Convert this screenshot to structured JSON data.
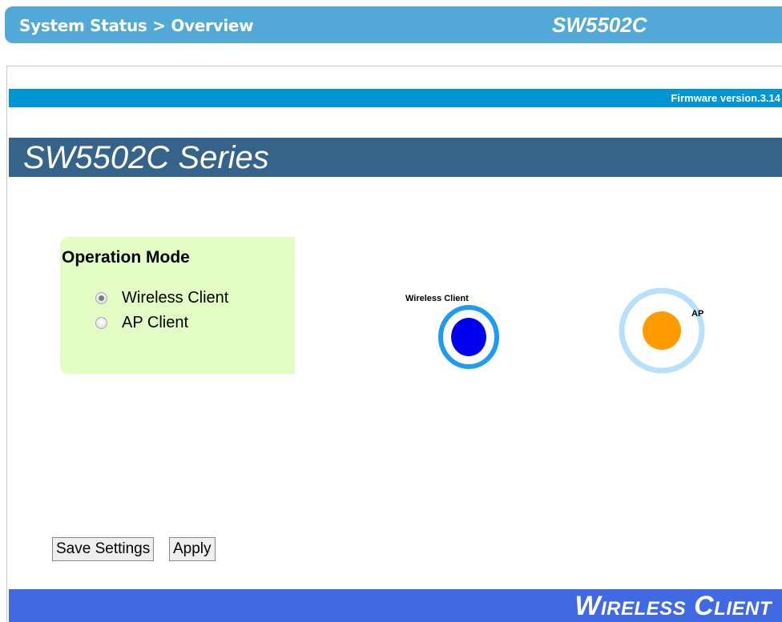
{
  "header": {
    "breadcrumb": "System Status > Overview",
    "model": "SW5502C"
  },
  "firmware": {
    "version_label": "Firmware version.3.14"
  },
  "series": {
    "title": "SW5502C Series"
  },
  "operation_mode": {
    "title": "Operation Mode",
    "options": [
      {
        "label": "Wireless Client",
        "checked": true
      },
      {
        "label": "AP Client",
        "checked": false
      }
    ]
  },
  "diagram": {
    "client_label": "Wireless Client",
    "ap_label": "AP",
    "colors": {
      "client_ring": "#1e9cf0",
      "client_dot": "#0000ee",
      "ap_ring": "#b8e0fa",
      "ap_dot": "#ff9a00"
    }
  },
  "buttons": {
    "save": "Save Settings",
    "apply": "Apply"
  },
  "footer": {
    "mode_title": "Wireless Client"
  },
  "colors": {
    "topbar": "#52a8d6",
    "firmware_bar": "#0095d3",
    "series_bar": "#36638a",
    "op_panel": "#e3fdc5",
    "footer_bar": "#4169e1"
  }
}
